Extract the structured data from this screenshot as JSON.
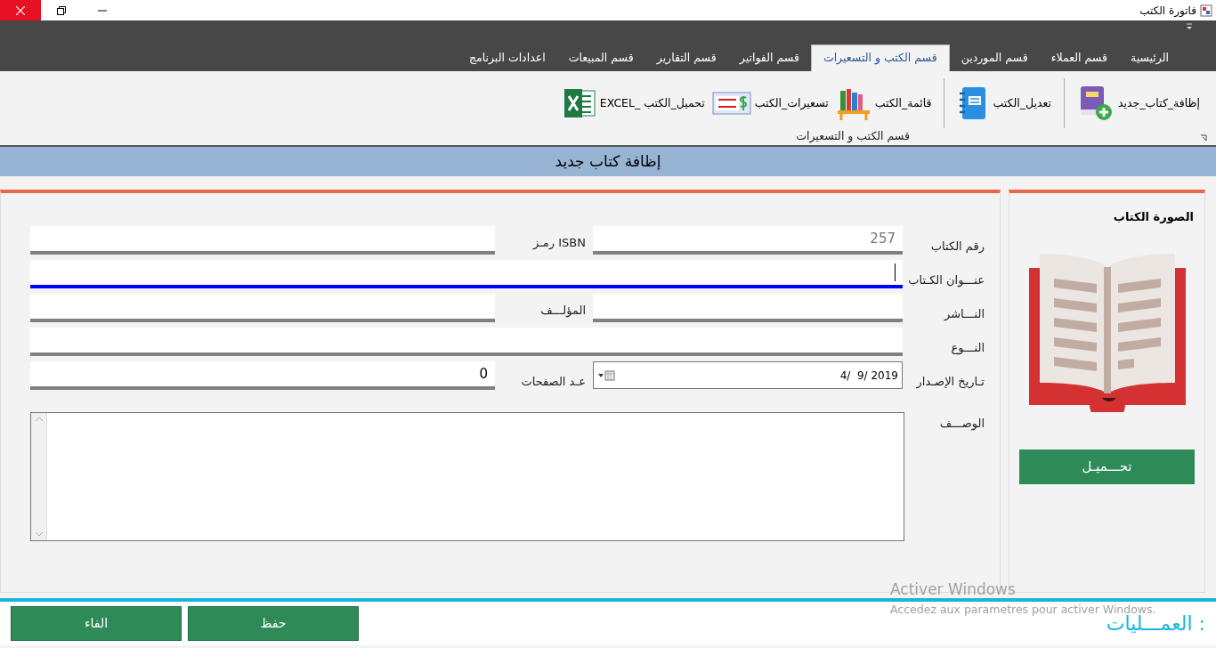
{
  "window": {
    "title": "فاتورة الكتب"
  },
  "tabs": [
    {
      "label": "الرئيسية",
      "selected": false
    },
    {
      "label": "قسم العملاء",
      "selected": false
    },
    {
      "label": "قسم الموردين",
      "selected": false
    },
    {
      "label": "قسم الكتب و التسعيرات",
      "selected": true
    },
    {
      "label": "قسم الفواتير",
      "selected": false
    },
    {
      "label": "قسم التقارير",
      "selected": false
    },
    {
      "label": "قسم المبيعات",
      "selected": false
    },
    {
      "label": "اعدادات البرنامج",
      "selected": false
    }
  ],
  "ribbon": {
    "items": [
      {
        "label": "إظافة_كتاب_جديد"
      },
      {
        "label": "تعديل_الكتب"
      },
      {
        "label": "قائمة_الكتب"
      },
      {
        "label": "تسعيرات_الكتب"
      },
      {
        "label": "EXCEL_ تحميل_الكتب"
      }
    ],
    "group_label": "قسم الكتب و التسعيرات"
  },
  "page_title": "إظافة كتاب جديد",
  "form": {
    "book_number": {
      "label": "رقم الكتاب",
      "value": "257"
    },
    "isbn": {
      "label": "رمـز ISBN"
    },
    "title": {
      "label": "عنـــوان الكـتاب",
      "focused": true
    },
    "publisher": {
      "label": "النـــاشر"
    },
    "author": {
      "label": "المؤلـــف"
    },
    "genre": {
      "label": "النـــوع"
    },
    "release_date": {
      "label": "تـاريخ الإصـدار",
      "value": "4/  9/ 2019"
    },
    "pages": {
      "label": "عـد الصفحات",
      "value": "0"
    },
    "description": {
      "label": "الوصـــف"
    }
  },
  "image_panel": {
    "title": "الصورة الكتاب",
    "button": "تحـــميـل"
  },
  "operations": {
    "label": "العمـــليات :",
    "buttons": [
      "حفظ",
      "الفاء"
    ]
  },
  "activation_notice": {
    "title": "Activer Windows",
    "text": "Accedez aux parametres pour activer Windows."
  }
}
